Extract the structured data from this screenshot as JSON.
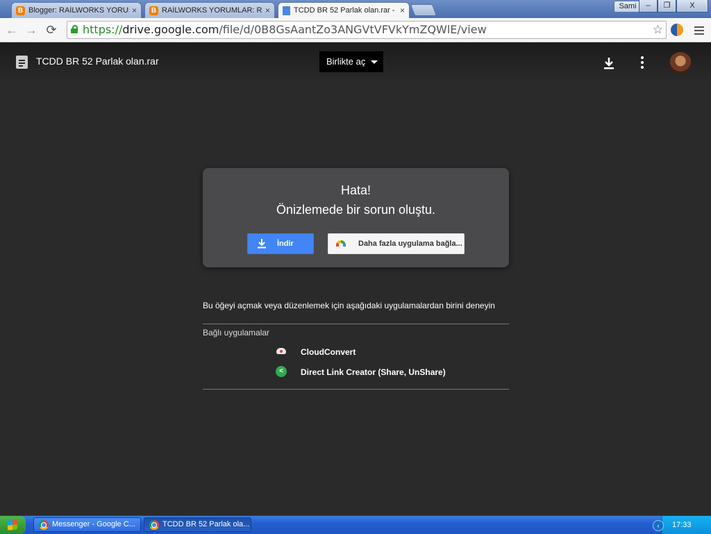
{
  "browser": {
    "tabs": [
      {
        "title": "Blogger: RAİLWORKS YORUM",
        "close": "×",
        "favicon": "blogger-icon"
      },
      {
        "title": "RAİLWORKS YORUMLAR: RA",
        "close": "×",
        "favicon": "blogger-icon"
      },
      {
        "title": "TCDD BR 52 Parlak olan.rar -",
        "close": "×",
        "favicon": "drive-file-icon"
      }
    ],
    "user": "Sami",
    "window_buttons": {
      "minimize": "–",
      "restore": "❐",
      "close": "X"
    },
    "url_scheme": "https://",
    "url_host": "drive.google.com",
    "url_path": "/file/d/0B8GsAantZo3ANGVtVFVkYmZQWlE/view",
    "nav": {
      "back": "←",
      "forward": "→",
      "reload": "⟳"
    },
    "star": "☆"
  },
  "drive": {
    "file_title": "TCDD BR 52 Parlak olan.rar",
    "open_with": "Birlikte aç",
    "error_title": "Hata!",
    "error_message": "Önizlemede bir sorun oluştu.",
    "download_button": "İndir",
    "more_apps_button": "Daha fazla uygulama bağla...",
    "suggestion_text": "Bu öğeyi açmak veya düzenlemek için aşağıdaki uygulamalardan birini deneyin",
    "connected_apps_label": "Bağlı uygulamalar",
    "apps": [
      {
        "name": "CloudConvert",
        "icon": "cloudconvert-icon"
      },
      {
        "name": "Direct Link Creator (Share, UnShare)",
        "icon": "share-icon"
      }
    ]
  },
  "taskbar": {
    "items": [
      {
        "label": "Messenger - Google C...",
        "active": false
      },
      {
        "label": "TCDD BR 52 Parlak ola...",
        "active": true
      }
    ],
    "clock": "17:33",
    "tray_chevron": "‹"
  }
}
